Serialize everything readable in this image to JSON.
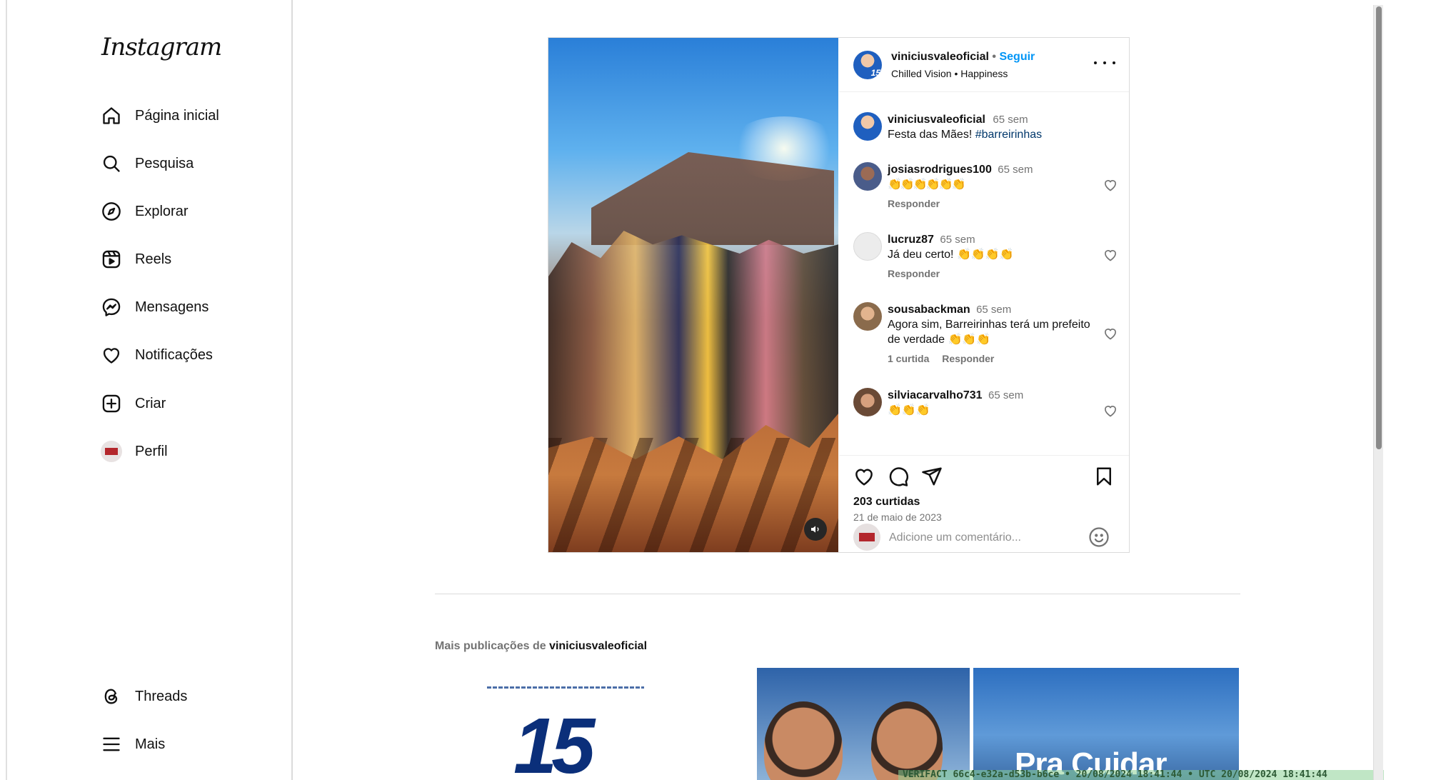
{
  "sidebar": {
    "logo": "Instagram",
    "items": [
      {
        "label": "Página inicial",
        "icon": "home-icon"
      },
      {
        "label": "Pesquisa",
        "icon": "search-icon"
      },
      {
        "label": "Explorar",
        "icon": "compass-icon"
      },
      {
        "label": "Reels",
        "icon": "reels-icon"
      },
      {
        "label": "Mensagens",
        "icon": "messenger-icon"
      },
      {
        "label": "Notificações",
        "icon": "heart-icon"
      },
      {
        "label": "Criar",
        "icon": "plus-square-icon"
      },
      {
        "label": "Perfil",
        "icon": "avatar"
      }
    ],
    "bottom_items": [
      {
        "label": "Threads",
        "icon": "threads-icon"
      },
      {
        "label": "Mais",
        "icon": "menu-icon"
      }
    ]
  },
  "post": {
    "author": "viniciusvaleoficial",
    "separator": "•",
    "follow_label": "Seguir",
    "audio": "Chilled Vision • Happiness",
    "avatar_number": "15",
    "caption": {
      "user": "viniciusvaleoficial",
      "time": "65 sem",
      "text": "Festa das Mães!",
      "hashtag": "#barreirinhas"
    },
    "comments": [
      {
        "user": "josiasrodrigues100",
        "time": "65 sem",
        "text": "👏👏👏👏👏👏",
        "likes": "",
        "reply": "Responder"
      },
      {
        "user": "lucruz87",
        "time": "65 sem",
        "text": "Já deu certo! 👏👏👏👏",
        "likes": "",
        "reply": "Responder"
      },
      {
        "user": "sousabackman",
        "time": "65 sem",
        "text": "Agora sim, Barreirinhas terá um prefeito de verdade 👏👏👏",
        "likes": "1 curtida",
        "reply": "Responder"
      },
      {
        "user": "silviacarvalho731",
        "time": "65 sem",
        "text": "👏👏👏",
        "likes": "",
        "reply": ""
      }
    ],
    "likes_count": "203 curtidas",
    "date": "21 de maio de 2023",
    "comment_placeholder": "Adicione um comentário..."
  },
  "more_posts": {
    "title_prefix": "Mais publicações de",
    "account": "viniciusvaleoficial",
    "thumb1_number": "15",
    "thumb3_text": "Pra Cuidar"
  },
  "watermark": "VERIFACT 66c4-e32a-d53b-b6ce • 20/08/2024 18:41:44 • UTC 20/08/2024 18:41:44",
  "colors": {
    "link_blue": "#0095f6",
    "hashtag": "#00376b",
    "muted": "#737373"
  }
}
